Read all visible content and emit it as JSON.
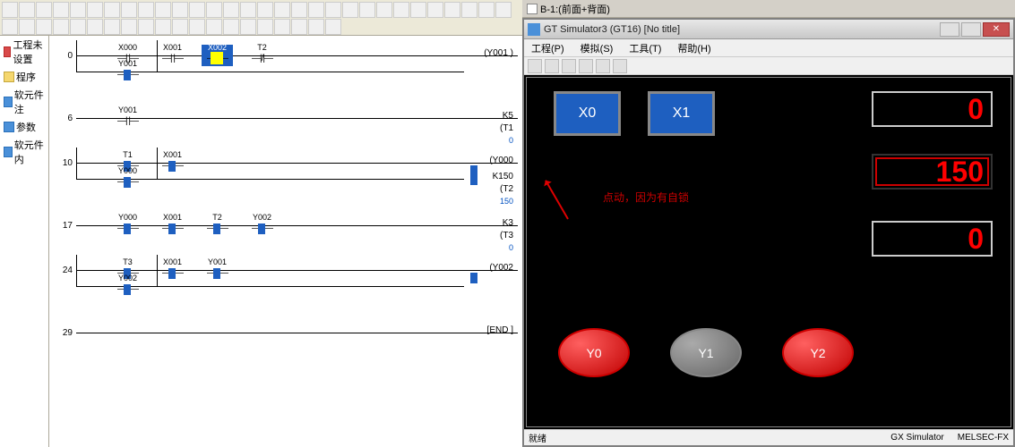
{
  "left": {
    "tree": {
      "items": [
        {
          "label": "工程未设置",
          "icon": "red"
        },
        {
          "label": "程序",
          "icon": "folder"
        },
        {
          "label": "软元件注",
          "icon": "blue"
        },
        {
          "label": "参数",
          "icon": "blue"
        },
        {
          "label": "软元件内",
          "icon": "blue"
        }
      ]
    },
    "rungs": [
      {
        "num": "0",
        "contacts": [
          {
            "label": "X000",
            "pos": 40
          },
          {
            "label": "X001",
            "pos": 90
          },
          {
            "label": "X002",
            "pos": 140,
            "hl": true,
            "active": true
          },
          {
            "label": "T2",
            "pos": 190,
            "nc": true
          }
        ],
        "out": "(Y001 )",
        "branch": {
          "label": "Y001",
          "pos": 40,
          "blue": true
        }
      },
      {
        "num": "6",
        "contacts": [
          {
            "label": "Y001",
            "pos": 40
          }
        ],
        "out": "K5",
        "out2": "(T1",
        "sub": "0"
      },
      {
        "num": "10",
        "contacts": [
          {
            "label": "T1",
            "pos": 40,
            "blue": true
          },
          {
            "label": "X001",
            "pos": 90,
            "blue": true
          }
        ],
        "out": "(Y000",
        "blue_out": true,
        "branch": {
          "label": "Y000",
          "pos": 40,
          "blue": true
        },
        "out_b": "K150",
        "out_b2": "(T2",
        "sub_b": "150",
        "blue_out_b": true
      },
      {
        "num": "17",
        "contacts": [
          {
            "label": "Y000",
            "pos": 40,
            "blue": true
          },
          {
            "label": "X001",
            "pos": 90,
            "blue": true
          },
          {
            "label": "T2",
            "pos": 140,
            "blue": true
          },
          {
            "label": "Y002",
            "pos": 190,
            "nc": true,
            "blue": true
          }
        ],
        "out": "K3",
        "out2": "(T3",
        "sub": "0"
      },
      {
        "num": "24",
        "contacts": [
          {
            "label": "T3",
            "pos": 40,
            "blue": true
          },
          {
            "label": "X001",
            "pos": 90,
            "blue": true
          },
          {
            "label": "Y001",
            "pos": 140,
            "blue": true
          }
        ],
        "out": "(Y002",
        "blue_out": true,
        "branch": {
          "label": "Y002",
          "pos": 40,
          "blue": true
        }
      },
      {
        "num": "29",
        "contacts": [],
        "out": "[END ]"
      }
    ]
  },
  "doc_tab": {
    "label": "B-1:(前面+背面)"
  },
  "sim": {
    "title": "GT Simulator3 (GT16)  [No title]",
    "menu": [
      "工程(P)",
      "模拟(S)",
      "工具(T)",
      "帮助(H)"
    ],
    "buttons": {
      "x0": "X0",
      "x1": "X1"
    },
    "annotation": "点动，因为有自锁",
    "displays": {
      "d1": "0",
      "d2": "150",
      "d3": "0"
    },
    "ovals": {
      "y0": "Y0",
      "y1": "Y1",
      "y2": "Y2"
    },
    "status": {
      "left": "就绪",
      "gx": "GX Simulator",
      "cpu": "MELSEC-FX"
    }
  }
}
